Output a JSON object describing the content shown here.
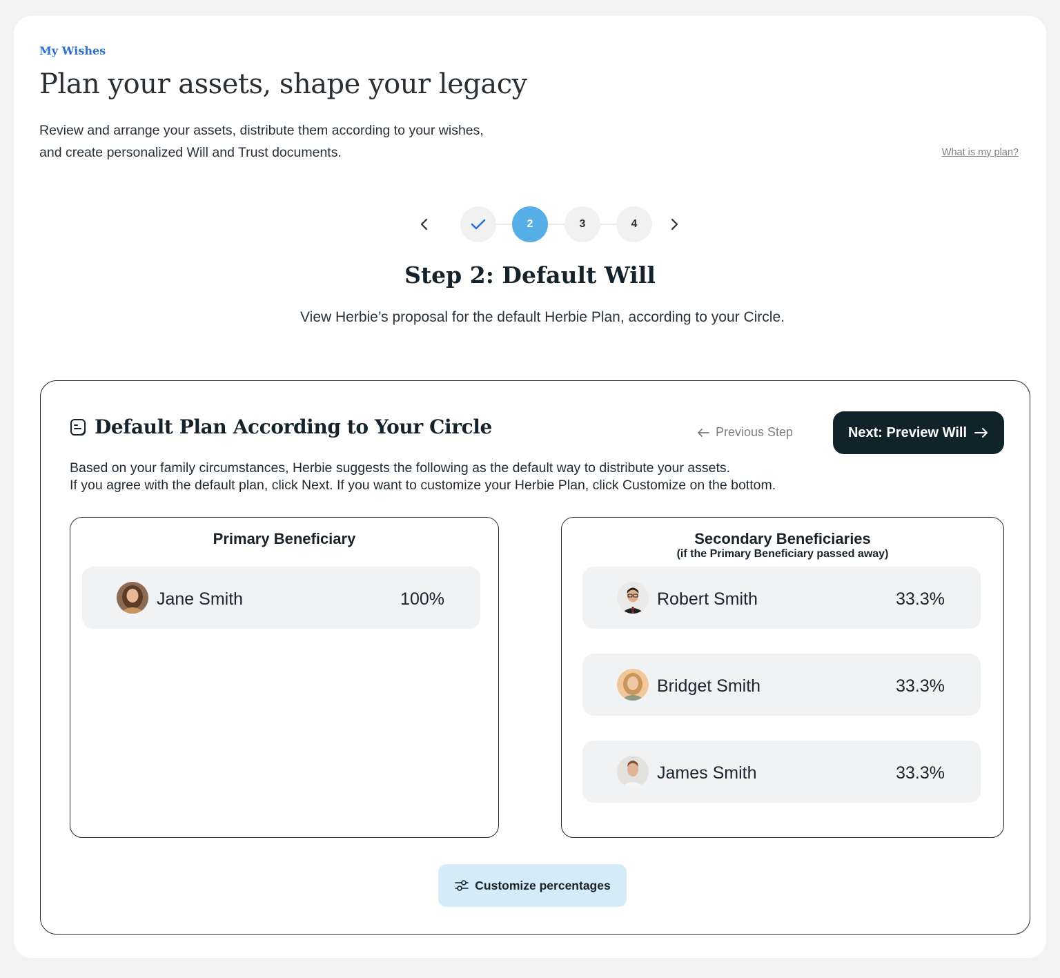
{
  "header": {
    "eyebrow": "My Wishes",
    "title": "Plan your assets, shape your legacy",
    "description_line1": "Review and arrange your assets, distribute them according to your wishes,",
    "description_line2": "and create personalized Will and Trust documents.",
    "help_link": "What is my plan?"
  },
  "stepper": {
    "steps": [
      {
        "label": "",
        "state": "completed",
        "icon": "check-icon"
      },
      {
        "label": "2",
        "state": "active"
      },
      {
        "label": "3",
        "state": "upcoming"
      },
      {
        "label": "4",
        "state": "upcoming"
      }
    ],
    "prev_icon": "chevron-left-icon",
    "next_icon": "chevron-right-icon"
  },
  "step": {
    "title": "Step 2: Default Will",
    "description": "View Herbie’s proposal for the default Herbie Plan, according to your Circle."
  },
  "card": {
    "icon": "document-icon",
    "title": "Default Plan According to Your Circle",
    "prev_label": "Previous Step",
    "next_label": "Next: Preview Will",
    "description_line1": "Based on your family circumstances, Herbie suggests the following as the default way to distribute your assets.",
    "description_line2": "If you agree with the default plan, click Next.  If you want to customize your Herbie Plan, click Customize on the bottom.",
    "primary": {
      "title": "Primary Beneficiary",
      "beneficiaries": [
        {
          "name": "Jane Smith",
          "percent": "100%"
        }
      ]
    },
    "secondary": {
      "title": "Secondary Beneficiaries",
      "subtitle": "(if the Primary Beneficiary passed away)",
      "beneficiaries": [
        {
          "name": "Robert Smith",
          "percent": "33.3%"
        },
        {
          "name": "Bridget Smith",
          "percent": "33.3%"
        },
        {
          "name": "James Smith",
          "percent": "33.3%"
        }
      ]
    },
    "customize_label": "Customize percentages",
    "customize_icon": "sliders-icon"
  },
  "colors": {
    "accent_blue": "#55aee6",
    "link_blue": "#2a6fd1",
    "primary_dark": "#10232b",
    "customize_bg": "#d6ebf8"
  }
}
